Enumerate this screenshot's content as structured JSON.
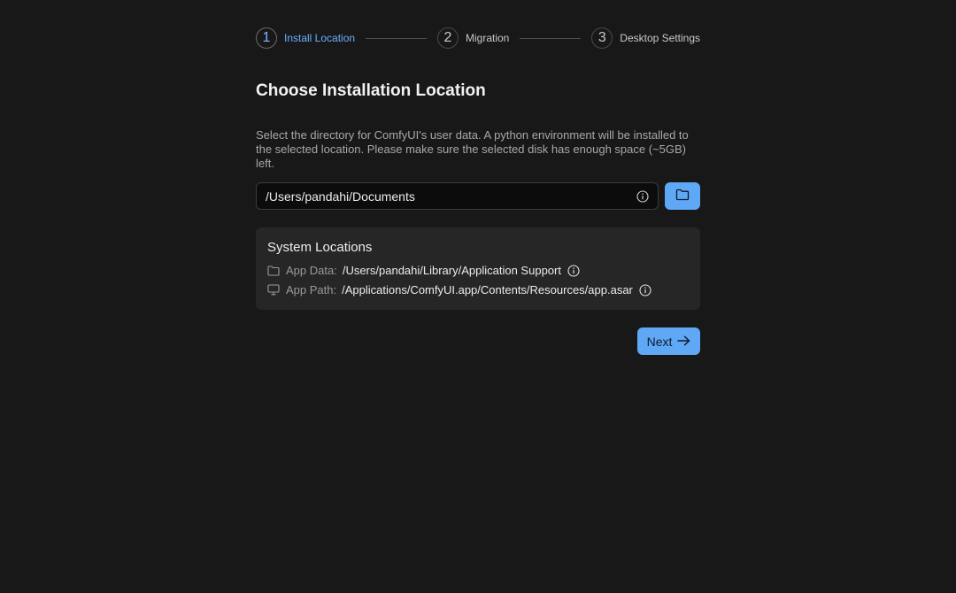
{
  "stepper": {
    "steps": [
      {
        "number": "1",
        "label": "Install Location",
        "active": true
      },
      {
        "number": "2",
        "label": "Migration",
        "active": false
      },
      {
        "number": "3",
        "label": "Desktop Settings",
        "active": false
      }
    ]
  },
  "main": {
    "title": "Choose Installation Location",
    "description": "Select the directory for ComfyUI's user data. A python environment will be installed to the selected location. Please make sure the selected disk has enough space (~5GB) left.",
    "path_input": {
      "value": "/Users/pandahi/Documents",
      "info_icon": "info-circle-icon"
    },
    "browse_button": {
      "icon": "folder-icon"
    }
  },
  "system_locations": {
    "title": "System Locations",
    "rows": [
      {
        "icon": "folder-icon",
        "label": "App Data:",
        "value": "/Users/pandahi/Library/Application Support"
      },
      {
        "icon": "monitor-icon",
        "label": "App Path:",
        "value": "/Applications/ComfyUI.app/Contents/Resources/app.asar"
      }
    ]
  },
  "footer": {
    "next_label": "Next",
    "next_icon": "arrow-right-icon"
  },
  "colors": {
    "accent": "#5fa8f5",
    "active_step": "#6aaeff",
    "background": "#181818",
    "panel": "#262626"
  }
}
